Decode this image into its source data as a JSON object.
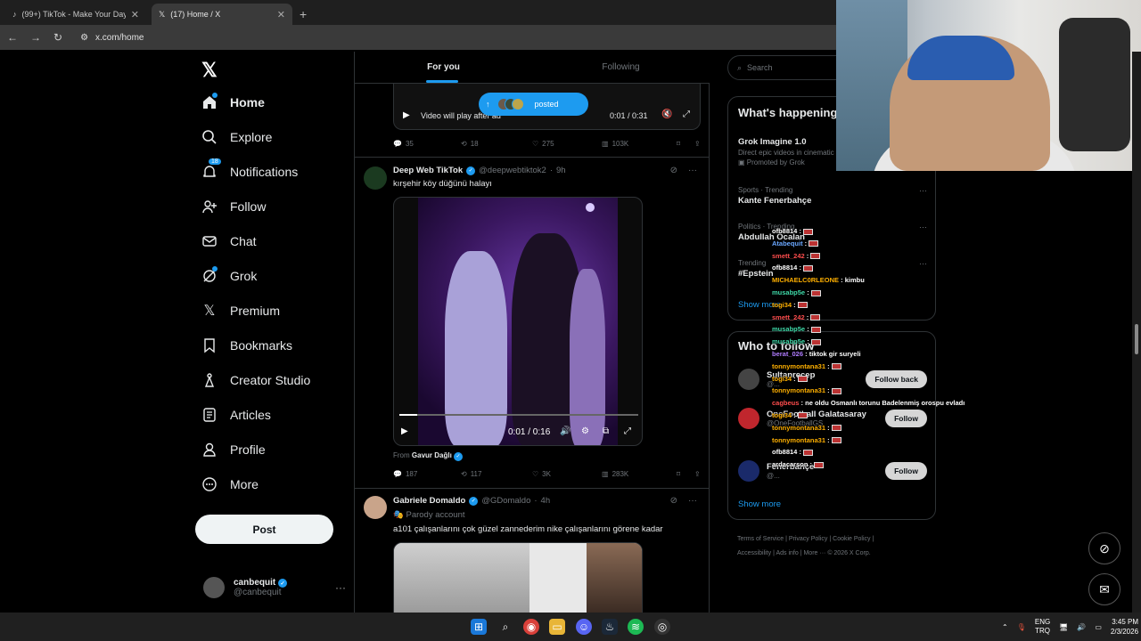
{
  "browser": {
    "tabs": [
      {
        "label": "(99+) TikTok - Make Your Day"
      },
      {
        "label": "(17) Home / X"
      }
    ],
    "url": "x.com/home"
  },
  "sidebar": {
    "items": [
      {
        "label": "Home",
        "icon": "home-icon"
      },
      {
        "label": "Explore",
        "icon": "search-icon"
      },
      {
        "label": "Notifications",
        "icon": "bell-icon",
        "badge": "18"
      },
      {
        "label": "Follow",
        "icon": "person-add-icon"
      },
      {
        "label": "Chat",
        "icon": "mail-icon"
      },
      {
        "label": "Grok",
        "icon": "grok-icon"
      },
      {
        "label": "Premium",
        "icon": "x-logo-icon"
      },
      {
        "label": "Bookmarks",
        "icon": "bookmark-icon"
      },
      {
        "label": "Creator Studio",
        "icon": "creator-studio-icon"
      },
      {
        "label": "Articles",
        "icon": "articles-icon"
      },
      {
        "label": "Profile",
        "icon": "profile-icon"
      },
      {
        "label": "More",
        "icon": "more-circle-icon"
      }
    ],
    "post_label": "Post",
    "account": {
      "name": "canbequit",
      "handle": "@canbequit"
    }
  },
  "feed": {
    "tabs": [
      "For you",
      "Following"
    ],
    "top_video": {
      "play_text": "Video will play after ad",
      "time": "0:01 / 0:31",
      "stats": [
        "35",
        "18",
        "275",
        "103K"
      ]
    },
    "posted_pill": "posted",
    "tweet1": {
      "name": "Deep Web TikTok",
      "handle": "@deepwebtiktok2",
      "time": "9h",
      "text": "kırşehir köy düğünü halayı",
      "video_time": "0:01 / 0:16",
      "from_prefix": "From",
      "from_name": "Gavur Dağlı",
      "stats": [
        "187",
        "117",
        "3K",
        "283K"
      ]
    },
    "tweet2": {
      "name": "Gabriele Domaldo",
      "handle": "@GDomaldo",
      "time": "4h",
      "badge": "Parody account",
      "text": "a101 çalışanlarını çok güzel zannederim nike çalışanlarını görene kadar"
    }
  },
  "right": {
    "search_placeholder": "Search",
    "happening_title": "What's happening",
    "trends": [
      {
        "cat": "",
        "name": "Grok Imagine 1.0",
        "sub": "Direct epic videos in cinematic",
        "promo": "Promoted by Grok"
      },
      {
        "cat": "Sports · Trending",
        "name": "Kante Fenerbahçe",
        "sub": ""
      },
      {
        "cat": "Politics · Trending",
        "name": "Abdullah Öcalan",
        "sub": ""
      },
      {
        "cat": "Trending",
        "name": "#Epstein",
        "sub": ""
      }
    ],
    "show_more": "Show more",
    "wtf_title": "Who to follow",
    "wtf": [
      {
        "name": "Sultanrecep",
        "handle": "@...",
        "btn": "Follow back"
      },
      {
        "name": "OneFootball Galatasaray",
        "handle": "@OneFootballGS",
        "btn": "Follow"
      },
      {
        "name": "Fenerbahçe",
        "handle": "@...",
        "btn": "Follow"
      }
    ],
    "show_more2": "Show more",
    "footer": [
      "Terms of Service",
      "Privacy Policy",
      "Cookie Policy",
      "Accessibility",
      "Ads info",
      "More ···",
      "© 2026 X Corp."
    ]
  },
  "chat": [
    {
      "user": "ofb8814",
      "color": "#ffffff",
      "msg": ""
    },
    {
      "user": "Atabequit",
      "color": "#6aa7ff",
      "msg": ""
    },
    {
      "user": "smett_242",
      "color": "#ff4d4d",
      "msg": ""
    },
    {
      "user": "ofb8814",
      "color": "#ffffff",
      "msg": ""
    },
    {
      "user": "MICHAELC0RLEONE",
      "color": "#ffb000",
      "msg": "kimbu"
    },
    {
      "user": "musabp5e",
      "color": "#3fd9a8",
      "msg": ""
    },
    {
      "user": "togi34",
      "color": "#ffb000",
      "msg": ""
    },
    {
      "user": "smett_242",
      "color": "#ff4d4d",
      "msg": ""
    },
    {
      "user": "musabp5e",
      "color": "#3fd9a8",
      "msg": ""
    },
    {
      "user": "musabp5e",
      "color": "#3fd9a8",
      "msg": ""
    },
    {
      "user": "berat_026",
      "color": "#b07cff",
      "msg": "tiktok gir suryeli"
    },
    {
      "user": "tonnymontana31",
      "color": "#ffb000",
      "msg": ""
    },
    {
      "user": "togi34",
      "color": "#ffb000",
      "msg": ""
    },
    {
      "user": "tonnymontana31",
      "color": "#ffb000",
      "msg": ""
    },
    {
      "user": "cagbeus",
      "color": "#ff4d4d",
      "msg": "ne oldu Osmanlı torunu Badelenmiş orospu evladı"
    },
    {
      "user": "togi34",
      "color": "#ffb000",
      "msg": ""
    },
    {
      "user": "tonnymontana31",
      "color": "#ffb000",
      "msg": ""
    },
    {
      "user": "tonnymontana31",
      "color": "#ffb000",
      "msg": ""
    },
    {
      "user": "ofb8814",
      "color": "#ffffff",
      "msg": ""
    },
    {
      "user": "ardacarson",
      "color": "#ffffff",
      "msg": ""
    }
  ],
  "taskbar": {
    "lang1": "ENG",
    "lang2": "TRQ",
    "time": "3:45 PM",
    "date": "2/3/2026"
  }
}
